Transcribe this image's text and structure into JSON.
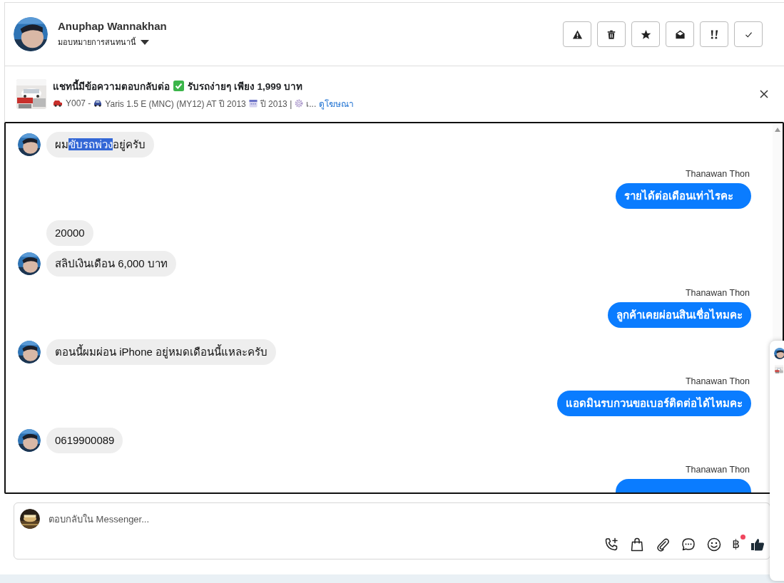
{
  "contact": {
    "name": "Anuphap Wannakhan",
    "assign_label": "มอบหมายการสนทนานี้"
  },
  "ad": {
    "title_before": "แชทนี้มีข้อความตอบกลับต่อ",
    "title_after": "รับรถง่ายๆ เพียง 1,999 บาท",
    "subtitle": [
      "Y007 -",
      "Yaris 1.5 E (MNC) (MY12) AT ปี 2013",
      "ปี 2013 |",
      "เ..."
    ],
    "link": "ดูโฆษณา"
  },
  "messages": [
    {
      "kind": "incoming",
      "avatar": true,
      "segments": [
        {
          "text": "ผม",
          "highlighted": false
        },
        {
          "text": "ขับรถพ่วง",
          "highlighted": true
        },
        {
          "text": "อยู่ครับ",
          "highlighted": false
        }
      ]
    },
    {
      "kind": "outgoing",
      "sender": "Thanawan Thon",
      "text": "รายได้ต่อเดือนเท่าไรคะ"
    },
    {
      "kind": "incoming",
      "avatar": false,
      "segments": [
        {
          "text": "20000",
          "highlighted": false
        }
      ]
    },
    {
      "kind": "incoming",
      "avatar": true,
      "segments": [
        {
          "text": "สลิปเงินเดือน 6,000 บาท",
          "highlighted": false
        }
      ]
    },
    {
      "kind": "outgoing",
      "sender": "Thanawan Thon",
      "text": "ลูกค้าเคยผ่อนสินเชื่อไหมคะ"
    },
    {
      "kind": "incoming",
      "avatar": true,
      "segments": [
        {
          "text": "ตอนนี้ผมผ่อน iPhone อยู่หมดเดือนนี้แหละครับ",
          "highlighted": false
        }
      ]
    },
    {
      "kind": "outgoing",
      "sender": "Thanawan Thon",
      "text": "แอดมินรบกวนขอเบอร์ติดต่อได้ไหมคะ"
    },
    {
      "kind": "incoming",
      "avatar": true,
      "segments": [
        {
          "text": "0619900089",
          "highlighted": false
        }
      ]
    },
    {
      "kind": "outgoing",
      "sender": "Thanawan Thon"
    }
  ],
  "composer": {
    "placeholder": "ตอบกลับใน Messenger...",
    "currency_symbol": "฿",
    "currency_badge": true
  }
}
